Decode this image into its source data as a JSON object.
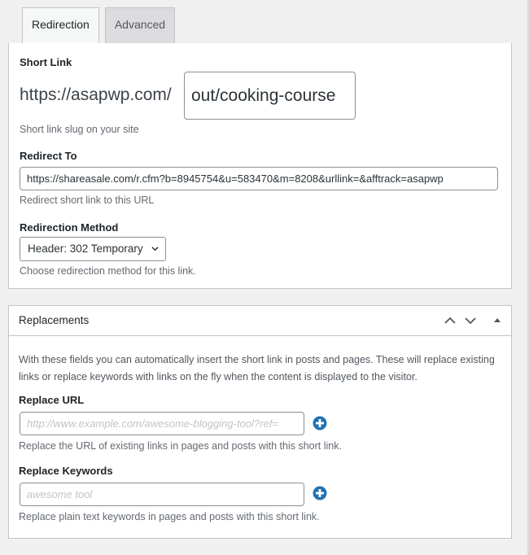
{
  "tabs": [
    {
      "label": "Redirection",
      "active": true
    },
    {
      "label": "Advanced",
      "active": false
    }
  ],
  "short_link": {
    "label": "Short Link",
    "prefix": "https://asapwp.com/",
    "slug_value": "out/cooking-course",
    "description": "Short link slug on your site"
  },
  "redirect_to": {
    "label": "Redirect To",
    "value": "https://shareasale.com/r.cfm?b=8945754&u=583470&m=8208&urllink=&afftrack=asapwp",
    "description": "Redirect short link to this URL"
  },
  "redirection_method": {
    "label": "Redirection Method",
    "selected": "Header: 302 Temporary",
    "description": "Choose redirection method for this link."
  },
  "replacements": {
    "title": "Replacements",
    "controls": [
      "move-up-icon",
      "move-down-icon",
      "toggle-panel-icon"
    ],
    "intro": "With these fields you can automatically insert the short link in posts and pages. These will replace existing links or replace keywords with links on the fly when the content is displayed to the visitor.",
    "replace_url": {
      "label": "Replace URL",
      "value": "",
      "placeholder": "http://www.example.com/awesome-blogging-tool?ref=",
      "description": "Replace the URL of existing links in pages and posts with this short link."
    },
    "replace_keywords": {
      "label": "Replace Keywords",
      "value": "",
      "placeholder": "awesome tool",
      "description": "Replace plain text keywords in pages and posts with this short link."
    }
  },
  "colors": {
    "accent": "#2271b1",
    "background": "#f0f0f1",
    "border": "#c3c4c7"
  }
}
